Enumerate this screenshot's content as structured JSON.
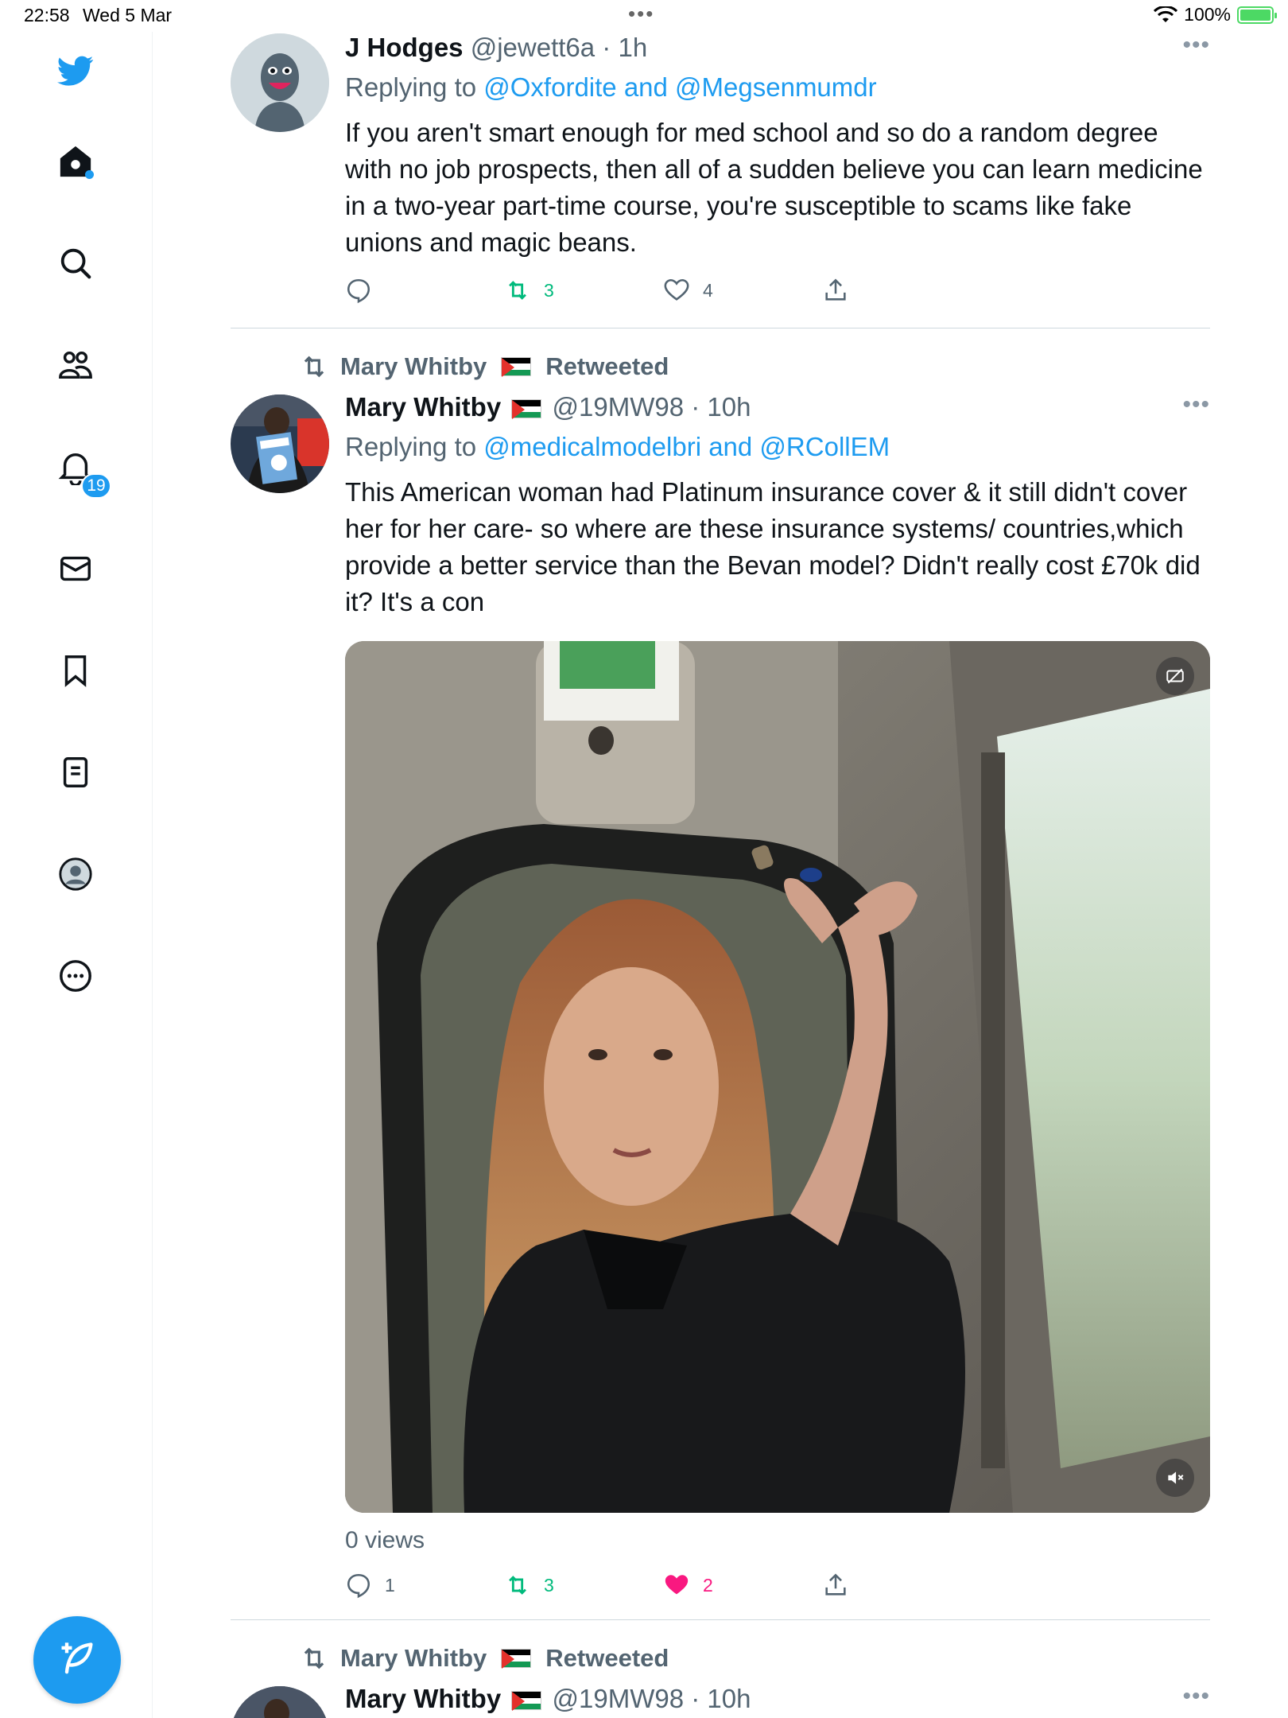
{
  "status_bar": {
    "time": "22:58",
    "date": "Wed 5 Mar",
    "battery": "100%"
  },
  "sidebar": {
    "notifications_badge": "19"
  },
  "tweets": [
    {
      "name": "J Hodges",
      "handle": "@jewett6a",
      "time": "1h",
      "reply_prefix": "Replying to ",
      "reply_links": "@Oxfordite and @Megsenmumdr",
      "text": "If you aren't smart enough for med school and so do a random degree with no job prospects, then all of a sudden believe you can learn medicine in a two-year part-time course, you're susceptible to scams like fake unions and magic beans.",
      "retweets": "3",
      "likes": "4"
    },
    {
      "retweeted_by": "Mary Whitby",
      "retweeted_label": "Retweeted",
      "name": "Mary Whitby",
      "handle": "@19MW98",
      "time": "10h",
      "reply_prefix": "Replying to ",
      "reply_links": "@medicalmodelbri and @RCollEM",
      "text": "This American woman had Platinum insurance cover & it still didn't cover her for her care- so where are these insurance systems/ countries,which provide a better service than the Bevan model? Didn't really cost £70k did it? It's a con",
      "views": "0 views",
      "replies": "1",
      "retweets": "3",
      "likes": "2"
    },
    {
      "retweeted_by": "Mary Whitby",
      "retweeted_label": "Retweeted",
      "name": "Mary Whitby",
      "handle": "@19MW98",
      "time": "10h"
    }
  ],
  "colors": {
    "accent": "#1d9bf0",
    "retweet": "#00ba7c",
    "like": "#f91880"
  }
}
